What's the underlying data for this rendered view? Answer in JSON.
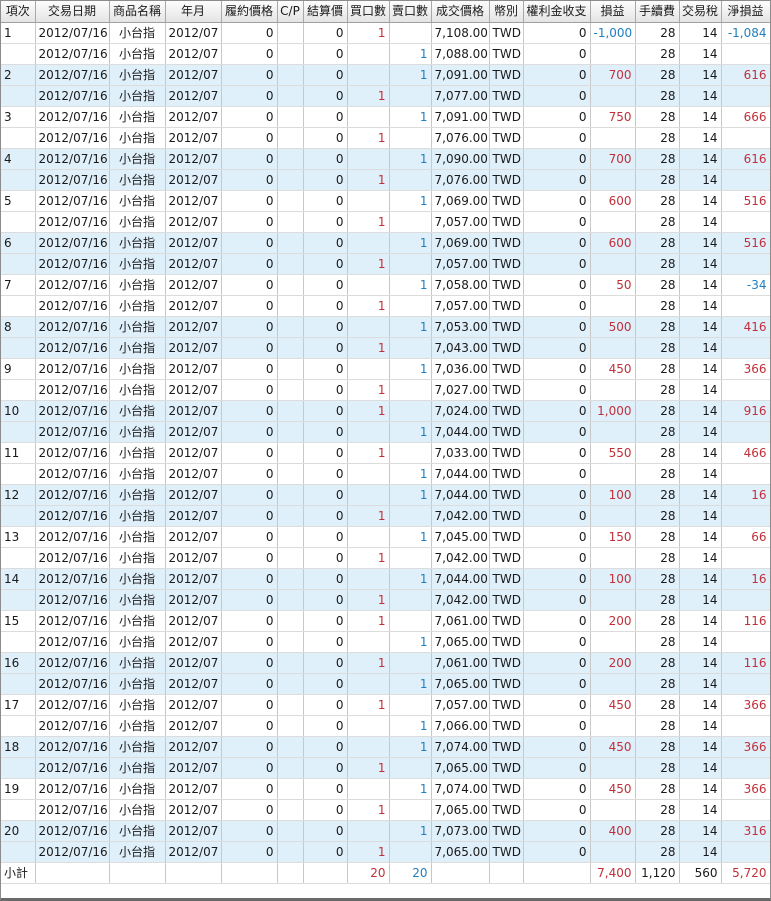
{
  "headers": [
    "項次",
    "交易日期",
    "商品名稱",
    "年月",
    "履約價格",
    "C/P",
    "結算價",
    "買口數",
    "賣口數",
    "成交價格",
    "幣別",
    "權利金收支",
    "損益",
    "手續費",
    "交易稅",
    "淨損益"
  ],
  "colors": {
    "row_blue": "#e0f0fb",
    "profit_red": "#c0303a",
    "loss_blue": "#1f7fc0"
  },
  "rows": [
    {
      "no": "1",
      "date": "2012/07/16",
      "product": "小台指",
      "ym": "2012/07",
      "strike": "0",
      "cp": "",
      "settle": "0",
      "buy": "1",
      "sell": "",
      "price": "7,108.00",
      "cur": "TWD",
      "premium": "0",
      "pl": "-1,000",
      "fee": "28",
      "tax": "14",
      "net": "-1,084"
    },
    {
      "no": "",
      "date": "2012/07/16",
      "product": "小台指",
      "ym": "2012/07",
      "strike": "0",
      "cp": "",
      "settle": "0",
      "buy": "",
      "sell": "1",
      "price": "7,088.00",
      "cur": "TWD",
      "premium": "0",
      "pl": "",
      "fee": "28",
      "tax": "14",
      "net": ""
    },
    {
      "no": "2",
      "date": "2012/07/16",
      "product": "小台指",
      "ym": "2012/07",
      "strike": "0",
      "cp": "",
      "settle": "0",
      "buy": "",
      "sell": "1",
      "price": "7,091.00",
      "cur": "TWD",
      "premium": "0",
      "pl": "700",
      "fee": "28",
      "tax": "14",
      "net": "616"
    },
    {
      "no": "",
      "date": "2012/07/16",
      "product": "小台指",
      "ym": "2012/07",
      "strike": "0",
      "cp": "",
      "settle": "0",
      "buy": "1",
      "sell": "",
      "price": "7,077.00",
      "cur": "TWD",
      "premium": "0",
      "pl": "",
      "fee": "28",
      "tax": "14",
      "net": ""
    },
    {
      "no": "3",
      "date": "2012/07/16",
      "product": "小台指",
      "ym": "2012/07",
      "strike": "0",
      "cp": "",
      "settle": "0",
      "buy": "",
      "sell": "1",
      "price": "7,091.00",
      "cur": "TWD",
      "premium": "0",
      "pl": "750",
      "fee": "28",
      "tax": "14",
      "net": "666"
    },
    {
      "no": "",
      "date": "2012/07/16",
      "product": "小台指",
      "ym": "2012/07",
      "strike": "0",
      "cp": "",
      "settle": "0",
      "buy": "1",
      "sell": "",
      "price": "7,076.00",
      "cur": "TWD",
      "premium": "0",
      "pl": "",
      "fee": "28",
      "tax": "14",
      "net": ""
    },
    {
      "no": "4",
      "date": "2012/07/16",
      "product": "小台指",
      "ym": "2012/07",
      "strike": "0",
      "cp": "",
      "settle": "0",
      "buy": "",
      "sell": "1",
      "price": "7,090.00",
      "cur": "TWD",
      "premium": "0",
      "pl": "700",
      "fee": "28",
      "tax": "14",
      "net": "616"
    },
    {
      "no": "",
      "date": "2012/07/16",
      "product": "小台指",
      "ym": "2012/07",
      "strike": "0",
      "cp": "",
      "settle": "0",
      "buy": "1",
      "sell": "",
      "price": "7,076.00",
      "cur": "TWD",
      "premium": "0",
      "pl": "",
      "fee": "28",
      "tax": "14",
      "net": ""
    },
    {
      "no": "5",
      "date": "2012/07/16",
      "product": "小台指",
      "ym": "2012/07",
      "strike": "0",
      "cp": "",
      "settle": "0",
      "buy": "",
      "sell": "1",
      "price": "7,069.00",
      "cur": "TWD",
      "premium": "0",
      "pl": "600",
      "fee": "28",
      "tax": "14",
      "net": "516"
    },
    {
      "no": "",
      "date": "2012/07/16",
      "product": "小台指",
      "ym": "2012/07",
      "strike": "0",
      "cp": "",
      "settle": "0",
      "buy": "1",
      "sell": "",
      "price": "7,057.00",
      "cur": "TWD",
      "premium": "0",
      "pl": "",
      "fee": "28",
      "tax": "14",
      "net": ""
    },
    {
      "no": "6",
      "date": "2012/07/16",
      "product": "小台指",
      "ym": "2012/07",
      "strike": "0",
      "cp": "",
      "settle": "0",
      "buy": "",
      "sell": "1",
      "price": "7,069.00",
      "cur": "TWD",
      "premium": "0",
      "pl": "600",
      "fee": "28",
      "tax": "14",
      "net": "516"
    },
    {
      "no": "",
      "date": "2012/07/16",
      "product": "小台指",
      "ym": "2012/07",
      "strike": "0",
      "cp": "",
      "settle": "0",
      "buy": "1",
      "sell": "",
      "price": "7,057.00",
      "cur": "TWD",
      "premium": "0",
      "pl": "",
      "fee": "28",
      "tax": "14",
      "net": ""
    },
    {
      "no": "7",
      "date": "2012/07/16",
      "product": "小台指",
      "ym": "2012/07",
      "strike": "0",
      "cp": "",
      "settle": "0",
      "buy": "",
      "sell": "1",
      "price": "7,058.00",
      "cur": "TWD",
      "premium": "0",
      "pl": "50",
      "fee": "28",
      "tax": "14",
      "net": "-34"
    },
    {
      "no": "",
      "date": "2012/07/16",
      "product": "小台指",
      "ym": "2012/07",
      "strike": "0",
      "cp": "",
      "settle": "0",
      "buy": "1",
      "sell": "",
      "price": "7,057.00",
      "cur": "TWD",
      "premium": "0",
      "pl": "",
      "fee": "28",
      "tax": "14",
      "net": ""
    },
    {
      "no": "8",
      "date": "2012/07/16",
      "product": "小台指",
      "ym": "2012/07",
      "strike": "0",
      "cp": "",
      "settle": "0",
      "buy": "",
      "sell": "1",
      "price": "7,053.00",
      "cur": "TWD",
      "premium": "0",
      "pl": "500",
      "fee": "28",
      "tax": "14",
      "net": "416"
    },
    {
      "no": "",
      "date": "2012/07/16",
      "product": "小台指",
      "ym": "2012/07",
      "strike": "0",
      "cp": "",
      "settle": "0",
      "buy": "1",
      "sell": "",
      "price": "7,043.00",
      "cur": "TWD",
      "premium": "0",
      "pl": "",
      "fee": "28",
      "tax": "14",
      "net": ""
    },
    {
      "no": "9",
      "date": "2012/07/16",
      "product": "小台指",
      "ym": "2012/07",
      "strike": "0",
      "cp": "",
      "settle": "0",
      "buy": "",
      "sell": "1",
      "price": "7,036.00",
      "cur": "TWD",
      "premium": "0",
      "pl": "450",
      "fee": "28",
      "tax": "14",
      "net": "366"
    },
    {
      "no": "",
      "date": "2012/07/16",
      "product": "小台指",
      "ym": "2012/07",
      "strike": "0",
      "cp": "",
      "settle": "0",
      "buy": "1",
      "sell": "",
      "price": "7,027.00",
      "cur": "TWD",
      "premium": "0",
      "pl": "",
      "fee": "28",
      "tax": "14",
      "net": ""
    },
    {
      "no": "10",
      "date": "2012/07/16",
      "product": "小台指",
      "ym": "2012/07",
      "strike": "0",
      "cp": "",
      "settle": "0",
      "buy": "1",
      "sell": "",
      "price": "7,024.00",
      "cur": "TWD",
      "premium": "0",
      "pl": "1,000",
      "fee": "28",
      "tax": "14",
      "net": "916"
    },
    {
      "no": "",
      "date": "2012/07/16",
      "product": "小台指",
      "ym": "2012/07",
      "strike": "0",
      "cp": "",
      "settle": "0",
      "buy": "",
      "sell": "1",
      "price": "7,044.00",
      "cur": "TWD",
      "premium": "0",
      "pl": "",
      "fee": "28",
      "tax": "14",
      "net": ""
    },
    {
      "no": "11",
      "date": "2012/07/16",
      "product": "小台指",
      "ym": "2012/07",
      "strike": "0",
      "cp": "",
      "settle": "0",
      "buy": "1",
      "sell": "",
      "price": "7,033.00",
      "cur": "TWD",
      "premium": "0",
      "pl": "550",
      "fee": "28",
      "tax": "14",
      "net": "466"
    },
    {
      "no": "",
      "date": "2012/07/16",
      "product": "小台指",
      "ym": "2012/07",
      "strike": "0",
      "cp": "",
      "settle": "0",
      "buy": "",
      "sell": "1",
      "price": "7,044.00",
      "cur": "TWD",
      "premium": "0",
      "pl": "",
      "fee": "28",
      "tax": "14",
      "net": ""
    },
    {
      "no": "12",
      "date": "2012/07/16",
      "product": "小台指",
      "ym": "2012/07",
      "strike": "0",
      "cp": "",
      "settle": "0",
      "buy": "",
      "sell": "1",
      "price": "7,044.00",
      "cur": "TWD",
      "premium": "0",
      "pl": "100",
      "fee": "28",
      "tax": "14",
      "net": "16"
    },
    {
      "no": "",
      "date": "2012/07/16",
      "product": "小台指",
      "ym": "2012/07",
      "strike": "0",
      "cp": "",
      "settle": "0",
      "buy": "1",
      "sell": "",
      "price": "7,042.00",
      "cur": "TWD",
      "premium": "0",
      "pl": "",
      "fee": "28",
      "tax": "14",
      "net": ""
    },
    {
      "no": "13",
      "date": "2012/07/16",
      "product": "小台指",
      "ym": "2012/07",
      "strike": "0",
      "cp": "",
      "settle": "0",
      "buy": "",
      "sell": "1",
      "price": "7,045.00",
      "cur": "TWD",
      "premium": "0",
      "pl": "150",
      "fee": "28",
      "tax": "14",
      "net": "66"
    },
    {
      "no": "",
      "date": "2012/07/16",
      "product": "小台指",
      "ym": "2012/07",
      "strike": "0",
      "cp": "",
      "settle": "0",
      "buy": "1",
      "sell": "",
      "price": "7,042.00",
      "cur": "TWD",
      "premium": "0",
      "pl": "",
      "fee": "28",
      "tax": "14",
      "net": ""
    },
    {
      "no": "14",
      "date": "2012/07/16",
      "product": "小台指",
      "ym": "2012/07",
      "strike": "0",
      "cp": "",
      "settle": "0",
      "buy": "",
      "sell": "1",
      "price": "7,044.00",
      "cur": "TWD",
      "premium": "0",
      "pl": "100",
      "fee": "28",
      "tax": "14",
      "net": "16"
    },
    {
      "no": "",
      "date": "2012/07/16",
      "product": "小台指",
      "ym": "2012/07",
      "strike": "0",
      "cp": "",
      "settle": "0",
      "buy": "1",
      "sell": "",
      "price": "7,042.00",
      "cur": "TWD",
      "premium": "0",
      "pl": "",
      "fee": "28",
      "tax": "14",
      "net": ""
    },
    {
      "no": "15",
      "date": "2012/07/16",
      "product": "小台指",
      "ym": "2012/07",
      "strike": "0",
      "cp": "",
      "settle": "0",
      "buy": "1",
      "sell": "",
      "price": "7,061.00",
      "cur": "TWD",
      "premium": "0",
      "pl": "200",
      "fee": "28",
      "tax": "14",
      "net": "116"
    },
    {
      "no": "",
      "date": "2012/07/16",
      "product": "小台指",
      "ym": "2012/07",
      "strike": "0",
      "cp": "",
      "settle": "0",
      "buy": "",
      "sell": "1",
      "price": "7,065.00",
      "cur": "TWD",
      "premium": "0",
      "pl": "",
      "fee": "28",
      "tax": "14",
      "net": ""
    },
    {
      "no": "16",
      "date": "2012/07/16",
      "product": "小台指",
      "ym": "2012/07",
      "strike": "0",
      "cp": "",
      "settle": "0",
      "buy": "1",
      "sell": "",
      "price": "7,061.00",
      "cur": "TWD",
      "premium": "0",
      "pl": "200",
      "fee": "28",
      "tax": "14",
      "net": "116"
    },
    {
      "no": "",
      "date": "2012/07/16",
      "product": "小台指",
      "ym": "2012/07",
      "strike": "0",
      "cp": "",
      "settle": "0",
      "buy": "",
      "sell": "1",
      "price": "7,065.00",
      "cur": "TWD",
      "premium": "0",
      "pl": "",
      "fee": "28",
      "tax": "14",
      "net": ""
    },
    {
      "no": "17",
      "date": "2012/07/16",
      "product": "小台指",
      "ym": "2012/07",
      "strike": "0",
      "cp": "",
      "settle": "0",
      "buy": "1",
      "sell": "",
      "price": "7,057.00",
      "cur": "TWD",
      "premium": "0",
      "pl": "450",
      "fee": "28",
      "tax": "14",
      "net": "366"
    },
    {
      "no": "",
      "date": "2012/07/16",
      "product": "小台指",
      "ym": "2012/07",
      "strike": "0",
      "cp": "",
      "settle": "0",
      "buy": "",
      "sell": "1",
      "price": "7,066.00",
      "cur": "TWD",
      "premium": "0",
      "pl": "",
      "fee": "28",
      "tax": "14",
      "net": ""
    },
    {
      "no": "18",
      "date": "2012/07/16",
      "product": "小台指",
      "ym": "2012/07",
      "strike": "0",
      "cp": "",
      "settle": "0",
      "buy": "",
      "sell": "1",
      "price": "7,074.00",
      "cur": "TWD",
      "premium": "0",
      "pl": "450",
      "fee": "28",
      "tax": "14",
      "net": "366"
    },
    {
      "no": "",
      "date": "2012/07/16",
      "product": "小台指",
      "ym": "2012/07",
      "strike": "0",
      "cp": "",
      "settle": "0",
      "buy": "1",
      "sell": "",
      "price": "7,065.00",
      "cur": "TWD",
      "premium": "0",
      "pl": "",
      "fee": "28",
      "tax": "14",
      "net": ""
    },
    {
      "no": "19",
      "date": "2012/07/16",
      "product": "小台指",
      "ym": "2012/07",
      "strike": "0",
      "cp": "",
      "settle": "0",
      "buy": "",
      "sell": "1",
      "price": "7,074.00",
      "cur": "TWD",
      "premium": "0",
      "pl": "450",
      "fee": "28",
      "tax": "14",
      "net": "366"
    },
    {
      "no": "",
      "date": "2012/07/16",
      "product": "小台指",
      "ym": "2012/07",
      "strike": "0",
      "cp": "",
      "settle": "0",
      "buy": "1",
      "sell": "",
      "price": "7,065.00",
      "cur": "TWD",
      "premium": "0",
      "pl": "",
      "fee": "28",
      "tax": "14",
      "net": ""
    },
    {
      "no": "20",
      "date": "2012/07/16",
      "product": "小台指",
      "ym": "2012/07",
      "strike": "0",
      "cp": "",
      "settle": "0",
      "buy": "",
      "sell": "1",
      "price": "7,073.00",
      "cur": "TWD",
      "premium": "0",
      "pl": "400",
      "fee": "28",
      "tax": "14",
      "net": "316"
    },
    {
      "no": "",
      "date": "2012/07/16",
      "product": "小台指",
      "ym": "2012/07",
      "strike": "0",
      "cp": "",
      "settle": "0",
      "buy": "1",
      "sell": "",
      "price": "7,065.00",
      "cur": "TWD",
      "premium": "0",
      "pl": "",
      "fee": "28",
      "tax": "14",
      "net": ""
    }
  ],
  "subtotal": {
    "label": "小計",
    "buy": "20",
    "sell": "20",
    "pl": "7,400",
    "fee": "1,120",
    "tax": "560",
    "net": "5,720"
  }
}
